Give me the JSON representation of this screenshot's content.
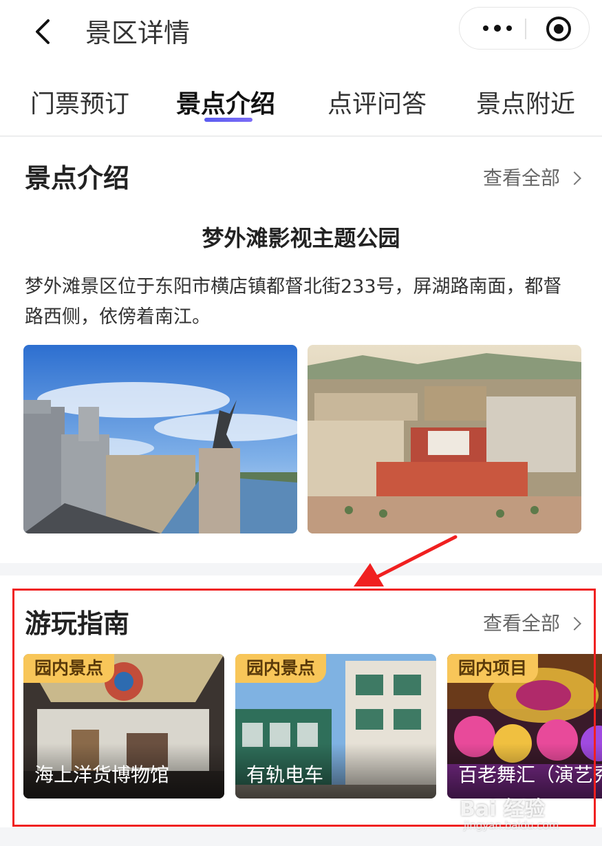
{
  "header": {
    "title": "景区详情"
  },
  "tabs": [
    {
      "label": "门票预订",
      "active": false
    },
    {
      "label": "景点介绍",
      "active": true
    },
    {
      "label": "点评问答",
      "active": false
    },
    {
      "label": "景点附近",
      "active": false
    }
  ],
  "intro": {
    "section_title": "景点介绍",
    "view_all": "查看全部",
    "park_name": "梦外滩影视主题公园",
    "description": "梦外滩景区位于东阳市横店镇都督北街233号，屏湖路南面，都督路西侧，依傍着南江。",
    "photos": [
      "seafront-street-photo",
      "aerial-park-photo"
    ]
  },
  "guide": {
    "section_title": "游玩指南",
    "view_all": "查看全部",
    "cards": [
      {
        "tag": "园内景点",
        "name": "海上洋货博物馆"
      },
      {
        "tag": "园内景点",
        "name": "有轨电车"
      },
      {
        "tag": "园内项目",
        "name": "百老舞汇（演艺秀"
      }
    ]
  },
  "annotation": {
    "highlight_color": "#f02020"
  },
  "watermark": {
    "brand": "Bai 经验",
    "url": "jingyan.baidu.com"
  },
  "colors": {
    "accent": "#5b5cf0",
    "tag_bg": "#f8c659"
  }
}
